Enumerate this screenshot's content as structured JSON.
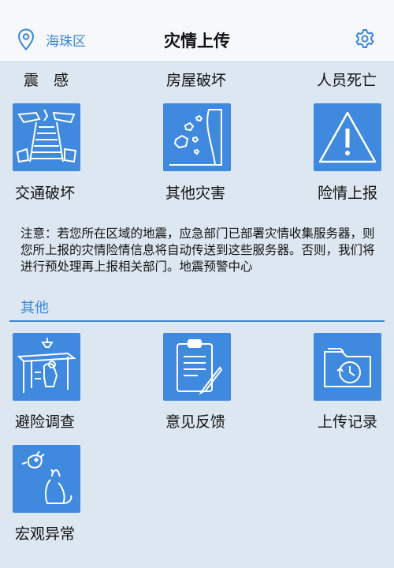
{
  "header": {
    "location": "海珠区",
    "title": "灾情上传"
  },
  "top_labels": [
    "震　感",
    "房屋破坏",
    "人员死亡"
  ],
  "grid1": [
    {
      "label": "交通破坏",
      "icon": "damaged-road-icon"
    },
    {
      "label": "其他灾害",
      "icon": "landslide-icon"
    },
    {
      "label": "险情上报",
      "icon": "warning-triangle-icon"
    }
  ],
  "notice": "注意：若您所在区域的地震，应急部门已部署灾情收集服务器，则您所上报的灾情险情信息将自动传送到这些服务器。否则，我们将进行预处理再上报相关部门。地震预警中心",
  "section": {
    "title": "其他"
  },
  "grid2": [
    {
      "label": "避险调查",
      "icon": "shelter-under-table-icon"
    },
    {
      "label": "意见反馈",
      "icon": "clipboard-pen-icon"
    },
    {
      "label": "上传记录",
      "icon": "folder-history-icon"
    },
    {
      "label": "宏观异常",
      "icon": "animal-anomaly-icon"
    }
  ],
  "colors": {
    "accent": "#3b87d6",
    "tile": "#3f89de",
    "background": "#dde7f1"
  }
}
